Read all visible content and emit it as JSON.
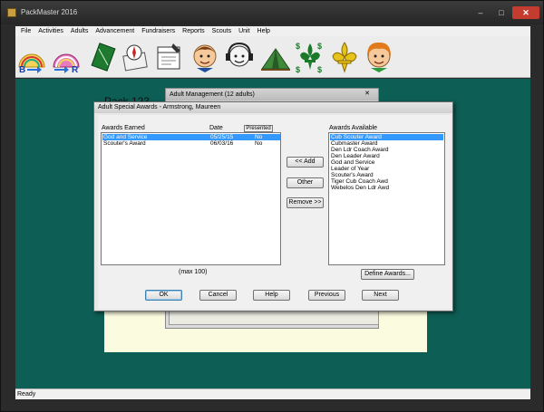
{
  "app": {
    "title": "PackMaster 2016",
    "window_controls": {
      "minimize": "–",
      "maximize": "□",
      "close": "✕"
    }
  },
  "menu": [
    "File",
    "Activities",
    "Adults",
    "Advancement",
    "Fundraisers",
    "Reports",
    "Scouts",
    "Unit",
    "Help"
  ],
  "toolbar": {
    "buttons": [
      {
        "name": "b-to-r-chart-icon",
        "text": "B"
      },
      {
        "name": "g-to-r-chart-icon",
        "text": "R"
      },
      {
        "name": "notebook-icon"
      },
      {
        "name": "compass-map-icon"
      },
      {
        "name": "calendar-planner-icon"
      },
      {
        "name": "scout-boy-icon"
      },
      {
        "name": "scout-boy-headphones-icon"
      },
      {
        "name": "tent-icon"
      },
      {
        "name": "money-fleur-de-lis-icon"
      },
      {
        "name": "fleur-de-lis-icon"
      },
      {
        "name": "scout-girl-icon"
      }
    ]
  },
  "background": {
    "pack_title": "Pack 123",
    "adult_mgmt_title": "Adult Management  (12 adults)",
    "adult_mgmt_close": "✕"
  },
  "dialog": {
    "title": "Adult Special Awards - Armstrong,  Maureen",
    "earned_header": "Awards Earned",
    "date_header": "Date",
    "presented_header": "Presented",
    "earned_rows": [
      {
        "award": "God and Service",
        "date": "05/25/15",
        "presented": "No",
        "selected": true
      },
      {
        "award": "Scouter's Award",
        "date": "06/03/16",
        "presented": "No",
        "selected": false
      }
    ],
    "max_note": "(max 100)",
    "available_header": "Awards Available",
    "available": [
      "Cub Scouter Award",
      "Cubmaster Award",
      "Den Ldr Coach Award",
      "Den Leader Award",
      "God and Service",
      "Leader of Year",
      "Scouter's Award",
      "Tiger Cub Coach Awd",
      "Webelos Den Ldr Awd"
    ],
    "available_selected_index": 0,
    "add_label": "<< Add",
    "other_label": "Other",
    "remove_label": "Remove >>",
    "define_label": "Define Awards...",
    "ok_label": "OK",
    "cancel_label": "Cancel",
    "help_label": "Help",
    "previous_label": "Previous",
    "next_label": "Next"
  },
  "status": {
    "text": "Ready"
  }
}
